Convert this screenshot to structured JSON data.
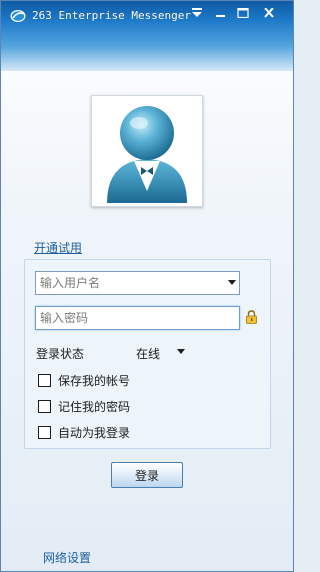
{
  "window": {
    "title": "263 Enterprise Messenger"
  },
  "titlebar_buttons": {
    "menu_icon": "menu-icon",
    "minimize_icon": "minimize-icon",
    "maximize_icon": "maximize-icon",
    "close_icon": "close-icon"
  },
  "avatar": {
    "icon": "user-avatar-icon"
  },
  "links": {
    "trial": "开通试用",
    "network_settings": "网络设置"
  },
  "login": {
    "username_placeholder": "输入用户名",
    "username_value": "",
    "password_placeholder": "输入密码",
    "password_value": "",
    "lock_icon": "lock-icon",
    "status_label": "登录状态",
    "status_value": "在线",
    "options": [
      {
        "label": "保存我的帐号",
        "checked": false
      },
      {
        "label": "记住我的密码",
        "checked": false
      },
      {
        "label": "自动为我登录",
        "checked": false
      }
    ],
    "submit_label": "登录"
  },
  "colors": {
    "titlebar_top": "#0f5aa3",
    "titlebar_mid": "#53a4dd",
    "link": "#1d5f9f",
    "panel_bg": "#edf4fa",
    "panel_border": "#c3d6e8"
  }
}
